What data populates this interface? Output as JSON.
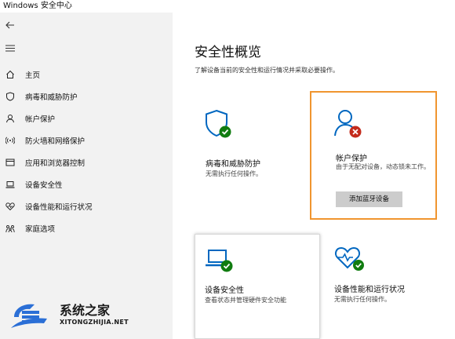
{
  "window": {
    "title": "Windows 安全中心"
  },
  "sidebar": {
    "items": [
      {
        "label": "主页",
        "icon": "home-icon"
      },
      {
        "label": "病毒和威胁防护",
        "icon": "shield-icon"
      },
      {
        "label": "帐户保护",
        "icon": "person-icon"
      },
      {
        "label": "防火墙和网络保护",
        "icon": "wifi-icon"
      },
      {
        "label": "应用和浏览器控制",
        "icon": "browser-window-icon"
      },
      {
        "label": "设备安全性",
        "icon": "laptop-icon"
      },
      {
        "label": "设备性能和运行状况",
        "icon": "heart-icon"
      },
      {
        "label": "家庭选项",
        "icon": "family-icon"
      }
    ]
  },
  "main": {
    "title": "安全性概览",
    "subtitle": "了解设备当前的安全性和运行情况并采取必要操作。",
    "cards": [
      {
        "title": "病毒和威胁防护",
        "desc": "无需执行任何操作。",
        "status": "ok"
      },
      {
        "title": "帐户保护",
        "desc": "由于无配对设备，动态锁未工作。",
        "status": "error",
        "button": "添加蓝牙设备"
      },
      {
        "title": "设备安全性",
        "desc": "查看状态并管理硬件安全功能",
        "status": "ok"
      },
      {
        "title": "设备性能和运行状况",
        "desc": "无需执行任何操作。",
        "status": "ok"
      }
    ]
  },
  "watermark": {
    "name": "系统之家",
    "url": "XITONGZHIJIA.NET"
  },
  "colors": {
    "accent": "#0067c0",
    "ok": "#107c10",
    "error": "#c42b1c",
    "highlight": "#f0952f"
  }
}
